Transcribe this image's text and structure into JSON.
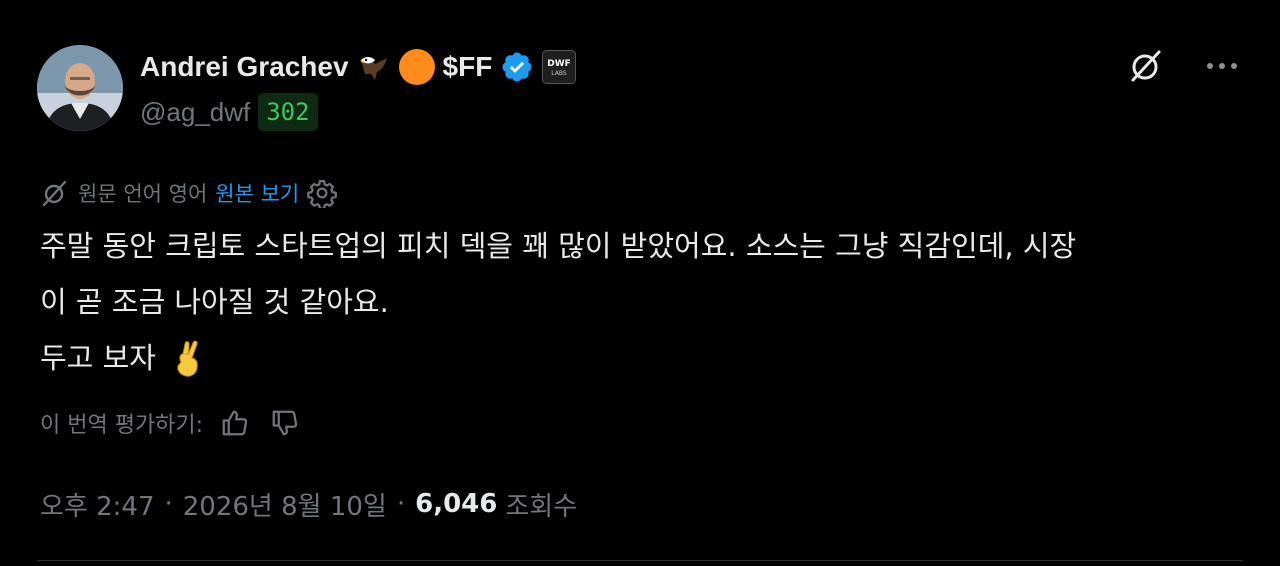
{
  "author": {
    "name": "Andrei Grachev",
    "badges": [
      "eagle-emoji",
      "orange-circle"
    ],
    "ticker": "$FF",
    "verified": true,
    "affiliate_logo_text": "DWF LABS",
    "handle": "@ag_dwf",
    "score": "302"
  },
  "translation": {
    "note": "원문 언어 영어",
    "show_original": "원본 보기"
  },
  "tweet": {
    "lines": [
      "주말 동안 크립토 스타트업의 피치 덱을 꽤 많이 받았어요. 소스는 그냥 직감인데, 시장",
      "이 곧 조금 나아질 것 같아요.",
      "두고 보자"
    ],
    "emoji": "crossed-fingers"
  },
  "rating": {
    "label": "이 번역 평가하기:"
  },
  "meta": {
    "time": "오후 2:47",
    "date": "2026년 8월 10일",
    "views": "6,046",
    "views_label": "조회수"
  },
  "colors": {
    "background": "#000000",
    "text": "#e7e9ea",
    "muted": "#71767b",
    "link": "#1d9bf0",
    "verified": "#1d9bf0",
    "score": "#41c463"
  }
}
